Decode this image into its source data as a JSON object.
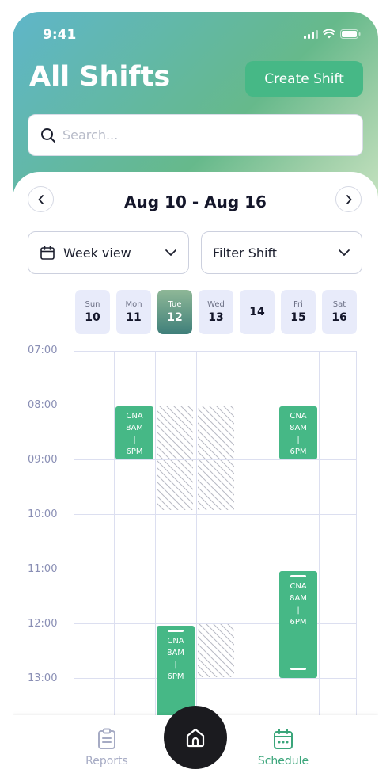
{
  "status": {
    "time": "9:41"
  },
  "header": {
    "title": "All Shifts",
    "create_label": "Create Shift"
  },
  "search": {
    "placeholder": "Search..."
  },
  "date_nav": {
    "range": "Aug 10 - Aug 16"
  },
  "dropdowns": {
    "view_label": "Week view",
    "filter_label": "Filter Shift"
  },
  "days": [
    {
      "name": "Sun",
      "num": "10",
      "active": false
    },
    {
      "name": "Mon",
      "num": "11",
      "active": false
    },
    {
      "name": "Tue",
      "num": "12",
      "active": true
    },
    {
      "name": "Wed",
      "num": "13",
      "active": false
    },
    {
      "name": "",
      "num": "14",
      "active": false
    },
    {
      "name": "Fri",
      "num": "15",
      "active": false
    },
    {
      "name": "Sat",
      "num": "16",
      "active": false
    }
  ],
  "times": [
    "07:00",
    "08:00",
    "09:00",
    "10:00",
    "11:00",
    "12:00",
    "13:00"
  ],
  "shifts": [
    {
      "role": "CNA",
      "start": "8AM",
      "sep": "|",
      "end": "6PM"
    },
    {
      "role": "CNA",
      "start": "8AM",
      "sep": "|",
      "end": "6PM"
    },
    {
      "role": "CNA",
      "start": "8AM",
      "sep": "|",
      "end": "6PM"
    },
    {
      "role": "CNA",
      "start": "8AM",
      "sep": "|",
      "end": "6PM"
    }
  ],
  "nav": {
    "reports": "Reports",
    "schedule": "Schedule"
  },
  "colors": {
    "accent": "#46b886",
    "active_nav": "#3aa57a",
    "muted_nav": "#a6abc4",
    "grid": "#dcdff0"
  }
}
